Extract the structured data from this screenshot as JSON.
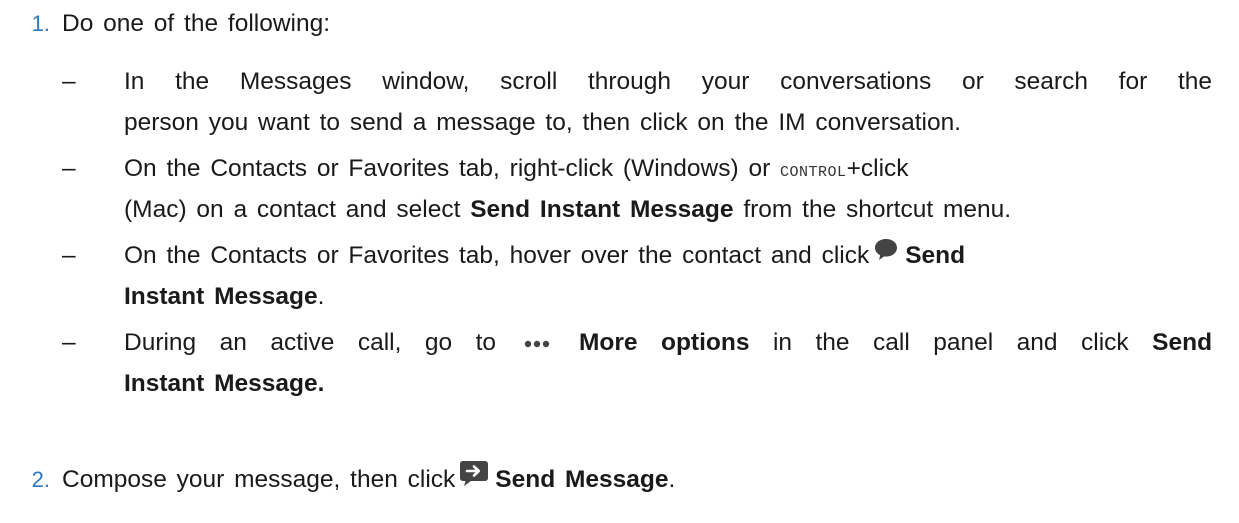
{
  "steps": [
    {
      "number": "1.",
      "text": "Do one of the following:"
    },
    {
      "number": "2.",
      "text_before": "Compose your message, then click",
      "icon": "send-message-icon",
      "bold": "Send Message",
      "text_after": "."
    }
  ],
  "sub_items": [
    {
      "line1": "In the Messages window, scroll through your conversations or search for the",
      "line2": "person you want to send a message to, then click on the IM conversation."
    },
    {
      "line1_before": "On the Contacts or Favorites tab, right-click (Windows) or",
      "key": "CONTROL",
      "line1_after": "+click",
      "line2_before": "(Mac) on a contact and select",
      "line2_bold": "Send Instant Message",
      "line2_after": "from the shortcut menu."
    },
    {
      "line1_before": "On the Contacts or Favorites tab, hover over the contact and click",
      "icon": "chat-bubble-icon",
      "line1_bold": "Send",
      "line2_bold": "Instant Message",
      "line2_after": "."
    },
    {
      "line1_before": "During an active call, go to",
      "icon": "more-options-icon",
      "line1_bold": "More options",
      "line1_middle": "in the call panel and click",
      "line1_bold2": "Send",
      "line2_bold": "Instant Message."
    }
  ],
  "dash": "–",
  "colors": {
    "step_number": "#2f78c4",
    "text": "#1a1a1a",
    "icon": "#444444"
  }
}
